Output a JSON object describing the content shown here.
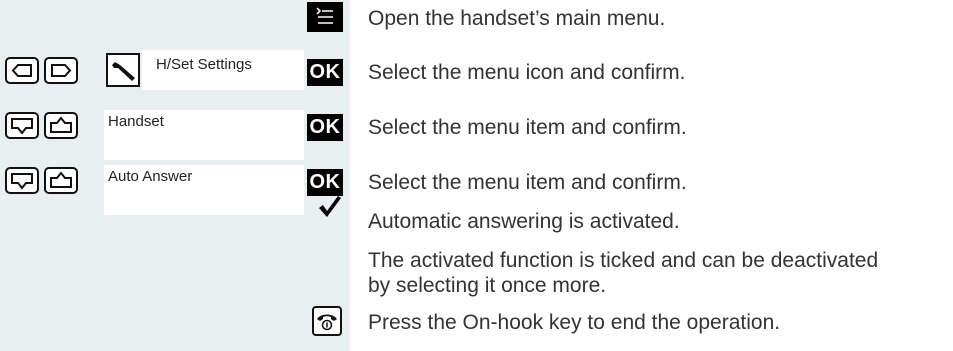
{
  "steps": {
    "menu": {
      "text": "Open the handset’s main menu."
    },
    "settings": {
      "label": "H/Set Settings",
      "ok": "OK",
      "text": "Select the menu icon and confirm."
    },
    "handset": {
      "label": "Handset",
      "ok": "OK",
      "text": "Select the menu item and confirm."
    },
    "auto_answer": {
      "label": "Auto Answer",
      "ok": "OK",
      "text": "Select the menu item and confirm."
    },
    "activated": {
      "text": "Automatic answering is activated."
    },
    "note": {
      "line1": "The activated function is ticked and can be deactivated",
      "line2": "by selecting it once more."
    },
    "end": {
      "text": "Press the On-hook key to end the operation."
    }
  },
  "icons": {
    "menu": "main-menu-icon",
    "left": "nav-left-icon",
    "right": "nav-right-icon",
    "down": "nav-down-icon",
    "up": "nav-up-icon",
    "tool": "wrench-icon",
    "check": "checkmark-icon",
    "onhook": "on-hook-key-icon"
  },
  "colors": {
    "panel": "#e9eef1",
    "key_fill": "#000000",
    "text": "#333333"
  }
}
